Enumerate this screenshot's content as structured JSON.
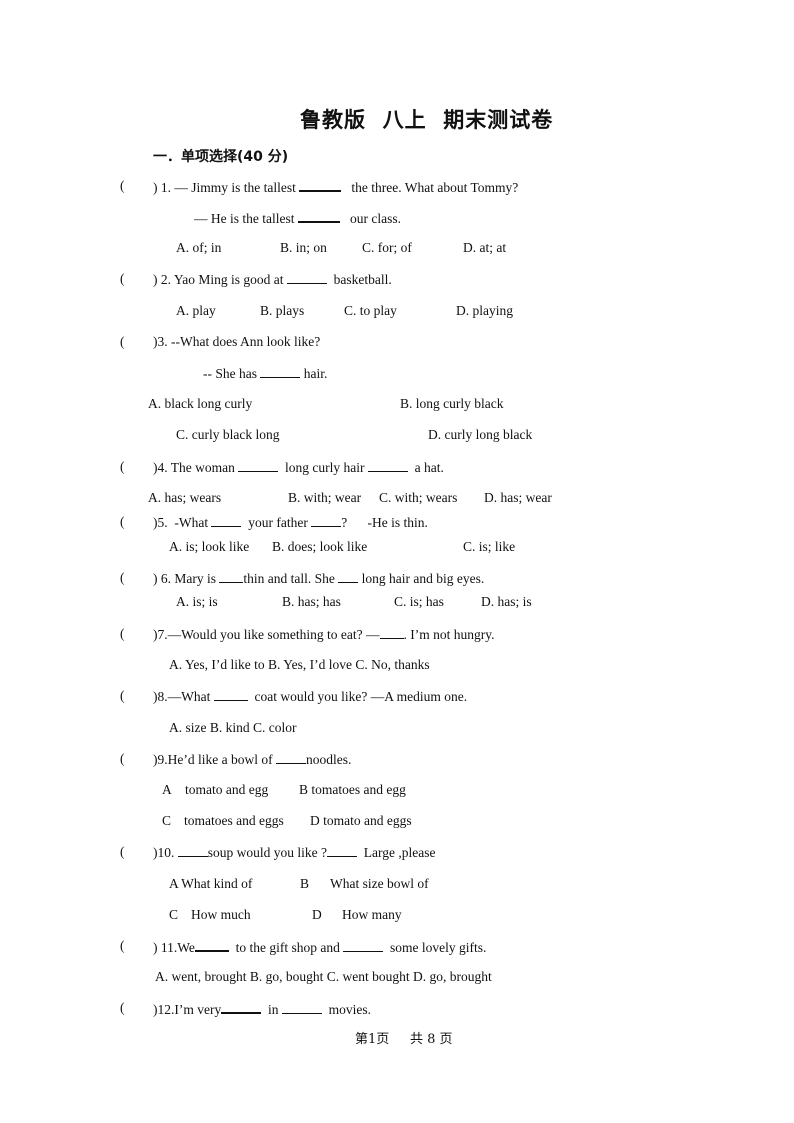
{
  "document": {
    "title": "鲁教版  八上  期末测试卷",
    "section_heading": "一．单项选择(40 分)",
    "paren_open": "(",
    "paren_close": ")",
    "questions": [
      {
        "number": "1.",
        "stem_parts": [
          "— Jimmy is the tallest ",
          " the three. What about Tommy?"
        ],
        "stem2_parts": [
          "— He is the tallest ",
          " our class."
        ],
        "options": [
          "A. of; in",
          "B. in; on",
          "C. for; of",
          "D. at; at"
        ]
      },
      {
        "number": "2.",
        "stem_parts": [
          "Yao Ming is good at ",
          " basketball."
        ],
        "options": [
          "A. play",
          "B. plays",
          "C. to play",
          "D. playing"
        ]
      },
      {
        "number": "3.",
        "stem": "--What does Ann look like?",
        "stem2_parts": [
          "-- She has ",
          " hair."
        ],
        "options": [
          "A. black long curly",
          "B. long curly black",
          "C. curly black long",
          "D. curly long black"
        ]
      },
      {
        "number": "4.",
        "stem_parts": [
          "The woman ",
          " long curly hair ",
          " a hat."
        ],
        "options": [
          "A. has; wears",
          "B. with; wear",
          "C. with; wears",
          "D. has; wear"
        ]
      },
      {
        "number": "5.",
        "stem_parts": [
          "-What ",
          " your father ",
          "?",
          "-He is thin."
        ],
        "options": [
          "A. is; look like",
          "B. does; look like",
          "C. is; like"
        ]
      },
      {
        "number": "6.",
        "stem_parts": [
          "Mary is ",
          "thin and tall. She ",
          " long hair and big eyes."
        ],
        "options": [
          "A. is; is",
          "B. has; has",
          "C. is; has",
          "D. has; is"
        ]
      },
      {
        "number": "7.",
        "stem_parts": [
          "—Would you like something to eat? —",
          ". I’m not hungry."
        ],
        "options_line": "A. Yes, I’d like to B. Yes, I’d love C. No, thanks"
      },
      {
        "number": "8.",
        "stem_parts": [
          "—What ",
          " coat would you like? —A medium one."
        ],
        "options_line": "A. size B. kind C. color"
      },
      {
        "number": "9.",
        "stem_parts": [
          "He’d like a bowl of ",
          "noodles."
        ],
        "options": [
          "A",
          "tomato and egg",
          "B tomatoes and egg",
          "C",
          "tomatoes and eggs",
          "D tomato and eggs"
        ]
      },
      {
        "number": "10.",
        "stem_parts": [
          "soup would you like ?",
          " Large ,please"
        ],
        "options": [
          "A What kind of",
          "B",
          "What size bowl of",
          "C",
          "How much",
          "D",
          "How many"
        ]
      },
      {
        "number": "11.",
        "stem_parts": [
          "We",
          " to the gift shop and ",
          " some lovely gifts."
        ],
        "options_line": "A. went, brought B. go, bought C. went bought D. go, brought"
      },
      {
        "number": "12.",
        "stem_parts": [
          "I’m very",
          " in ",
          " movies."
        ]
      }
    ],
    "footer": {
      "page_label": "第1页",
      "total_label": "共 8 页"
    }
  }
}
